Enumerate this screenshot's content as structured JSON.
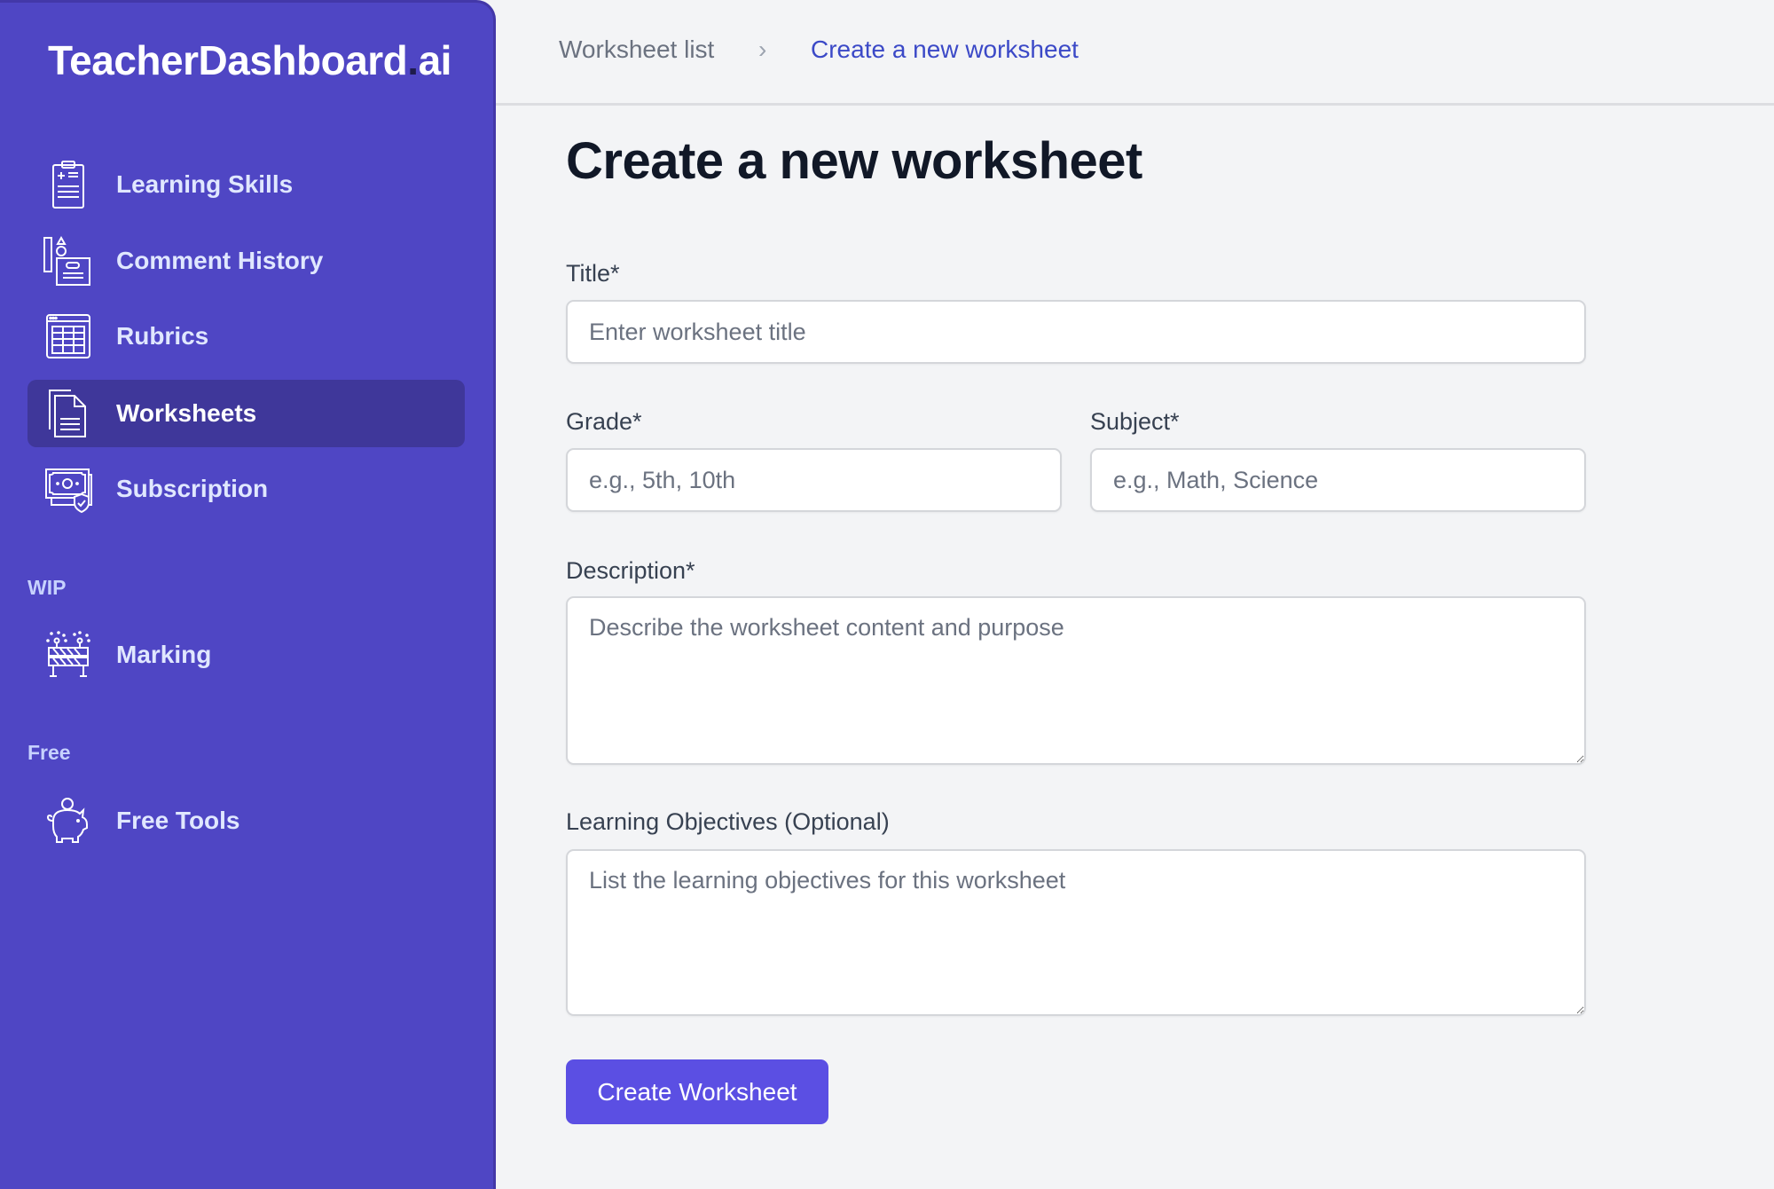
{
  "app": {
    "logo_main": "TeacherDashboard",
    "logo_dot": ".",
    "logo_suffix": "ai"
  },
  "sidebar": {
    "items": [
      {
        "label": "Learning Skills",
        "icon": "clipboard-icon",
        "active": false
      },
      {
        "label": "Comment History",
        "icon": "shapes-document-icon",
        "active": false
      },
      {
        "label": "Rubrics",
        "icon": "table-grid-icon",
        "active": false
      },
      {
        "label": "Worksheets",
        "icon": "documents-icon",
        "active": true
      },
      {
        "label": "Subscription",
        "icon": "money-shield-icon",
        "active": false
      }
    ],
    "sections": [
      {
        "label": "WIP",
        "items": [
          {
            "label": "Marking",
            "icon": "barrier-icon"
          }
        ]
      },
      {
        "label": "Free",
        "items": [
          {
            "label": "Free Tools",
            "icon": "piggy-bank-icon"
          }
        ]
      }
    ]
  },
  "breadcrumb": {
    "items": [
      "Worksheet list",
      "Create a new worksheet"
    ],
    "separator": "›"
  },
  "page": {
    "title": "Create a new worksheet"
  },
  "form": {
    "title": {
      "label": "Title*",
      "value": "",
      "placeholder": "Enter worksheet title"
    },
    "grade": {
      "label": "Grade*",
      "value": "",
      "placeholder": "e.g., 5th, 10th"
    },
    "subject": {
      "label": "Subject*",
      "value": "",
      "placeholder": "e.g., Math, Science"
    },
    "description": {
      "label": "Description*",
      "value": "",
      "placeholder": "Describe the worksheet content and purpose"
    },
    "objectives": {
      "label": "Learning Objectives (Optional)",
      "value": "",
      "placeholder": "List the learning objectives for this worksheet"
    },
    "submit_label": "Create Worksheet"
  },
  "colors": {
    "sidebar_bg": "#4f46c4",
    "sidebar_active": "#3f379a",
    "accent": "#5b4fe3",
    "breadcrumb_active": "#3b49c7",
    "page_bg": "#f3f4f6"
  }
}
